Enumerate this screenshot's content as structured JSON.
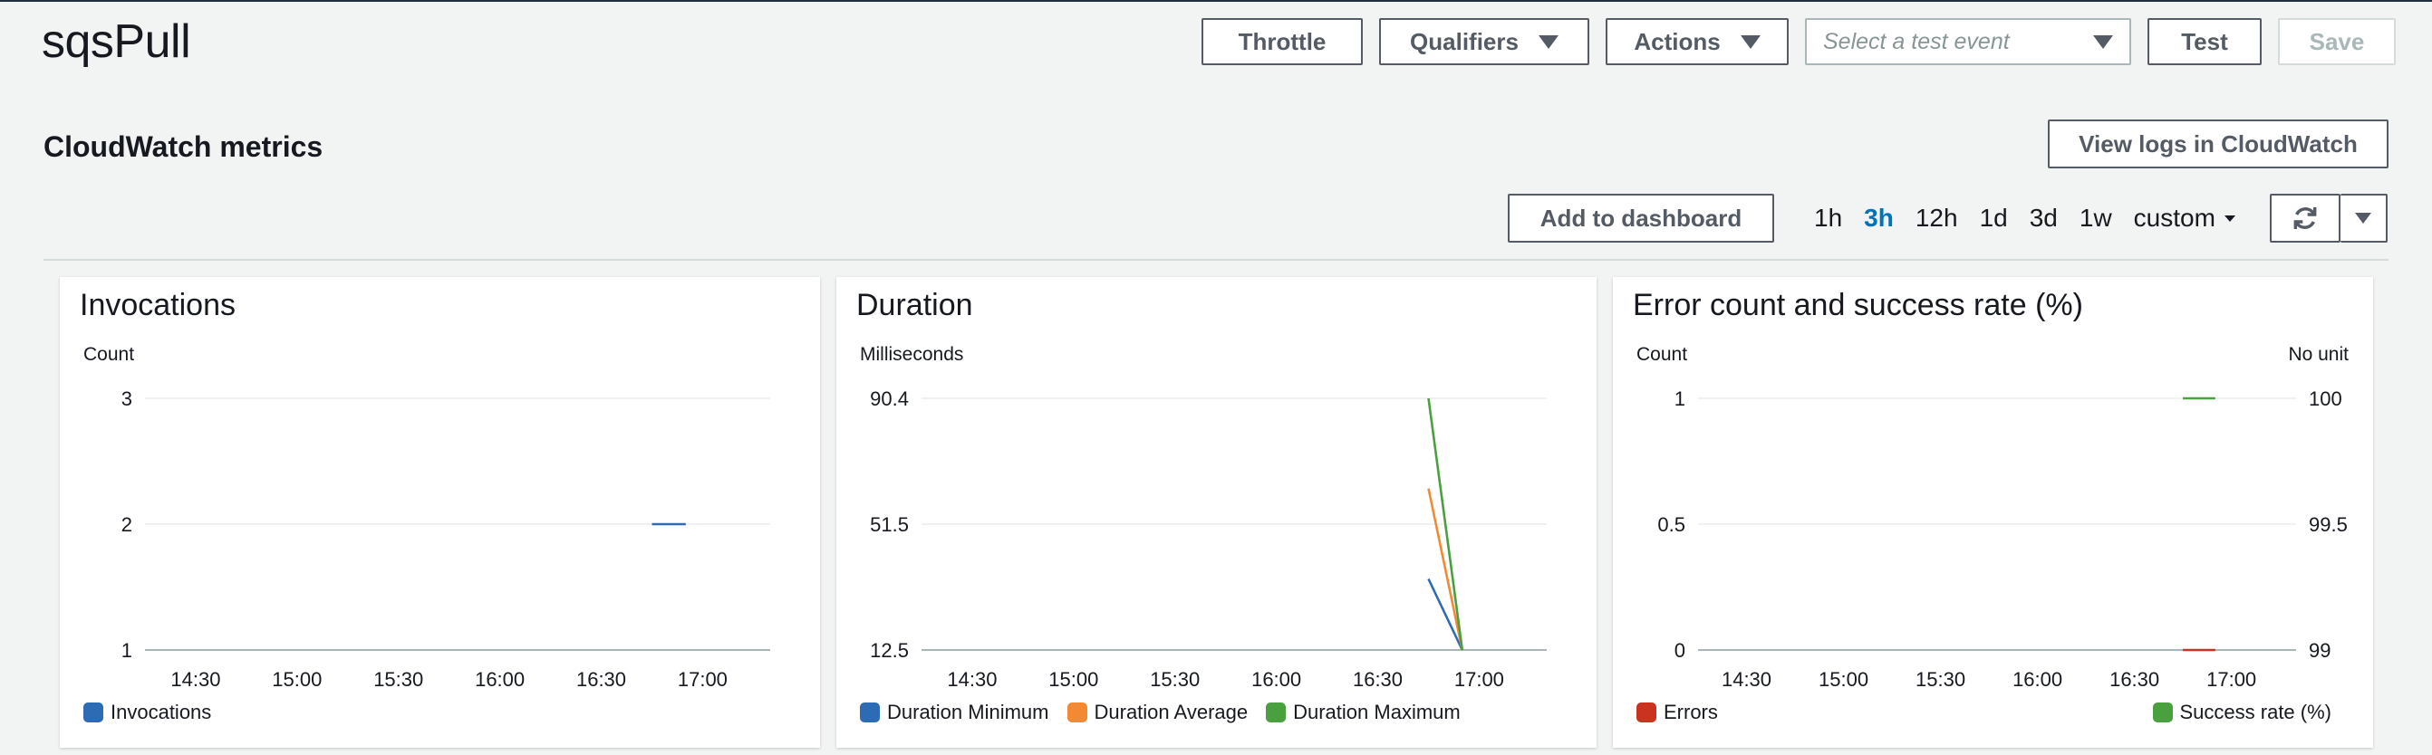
{
  "header": {
    "function_name": "sqsPull",
    "throttle_label": "Throttle",
    "qualifiers_label": "Qualifiers",
    "actions_label": "Actions",
    "test_event_placeholder": "Select a test event",
    "test_label": "Test",
    "save_label": "Save"
  },
  "section": {
    "title": "CloudWatch metrics",
    "view_logs_label": "View logs in CloudWatch",
    "add_dashboard_label": "Add to dashboard",
    "ranges": [
      "1h",
      "3h",
      "12h",
      "1d",
      "3d",
      "1w"
    ],
    "active_range": "3h",
    "custom_label": "custom"
  },
  "colors": {
    "blue": "#2e6bb5",
    "orange": "#f38a33",
    "green": "#4aa03f",
    "red": "#c9331f",
    "active_range": "#0073bb"
  },
  "chart_data": [
    {
      "type": "line",
      "title": "Invocations",
      "ylabel": "Count",
      "ylim": [
        1,
        3
      ],
      "y_ticks": [
        "3",
        "2",
        "1"
      ],
      "x_ticks": [
        "14:30",
        "15:00",
        "15:30",
        "16:00",
        "16:30",
        "17:00"
      ],
      "series": [
        {
          "name": "Invocations",
          "color": "#2e6bb5",
          "x": [
            "16:45",
            "16:55"
          ],
          "y": [
            2,
            2
          ]
        }
      ]
    },
    {
      "type": "line",
      "title": "Duration",
      "ylabel": "Milliseconds",
      "ylim": [
        12.5,
        90.4
      ],
      "y_ticks": [
        "90.4",
        "51.5",
        "12.5"
      ],
      "x_ticks": [
        "14:30",
        "15:00",
        "15:30",
        "16:00",
        "16:30",
        "17:00"
      ],
      "series": [
        {
          "name": "Duration Minimum",
          "color": "#2e6bb5",
          "x": [
            "16:45",
            "16:55"
          ],
          "y": [
            34.5,
            12.5
          ]
        },
        {
          "name": "Duration Average",
          "color": "#f38a33",
          "x": [
            "16:45",
            "16:55"
          ],
          "y": [
            62.5,
            12.5
          ]
        },
        {
          "name": "Duration Maximum",
          "color": "#4aa03f",
          "x": [
            "16:45",
            "16:55"
          ],
          "y": [
            90.4,
            12.5
          ]
        }
      ]
    },
    {
      "type": "line",
      "title": "Error count and success rate (%)",
      "ylabel": "Count",
      "ylabel_right": "No unit",
      "ylim": [
        0,
        1
      ],
      "ylim_right": [
        99,
        100
      ],
      "y_ticks": [
        "1",
        "0.5",
        "0"
      ],
      "y_ticks_right": [
        "100",
        "99.5",
        "99"
      ],
      "x_ticks": [
        "14:30",
        "15:00",
        "15:30",
        "16:00",
        "16:30",
        "17:00"
      ],
      "series": [
        {
          "name": "Errors",
          "color": "#c9331f",
          "axis": "left",
          "x": [
            "16:45",
            "16:55"
          ],
          "y": [
            0,
            0
          ]
        },
        {
          "name": "Success rate (%)",
          "color": "#4aa03f",
          "axis": "right",
          "x": [
            "16:45",
            "16:55"
          ],
          "y": [
            100,
            100
          ]
        }
      ]
    }
  ]
}
